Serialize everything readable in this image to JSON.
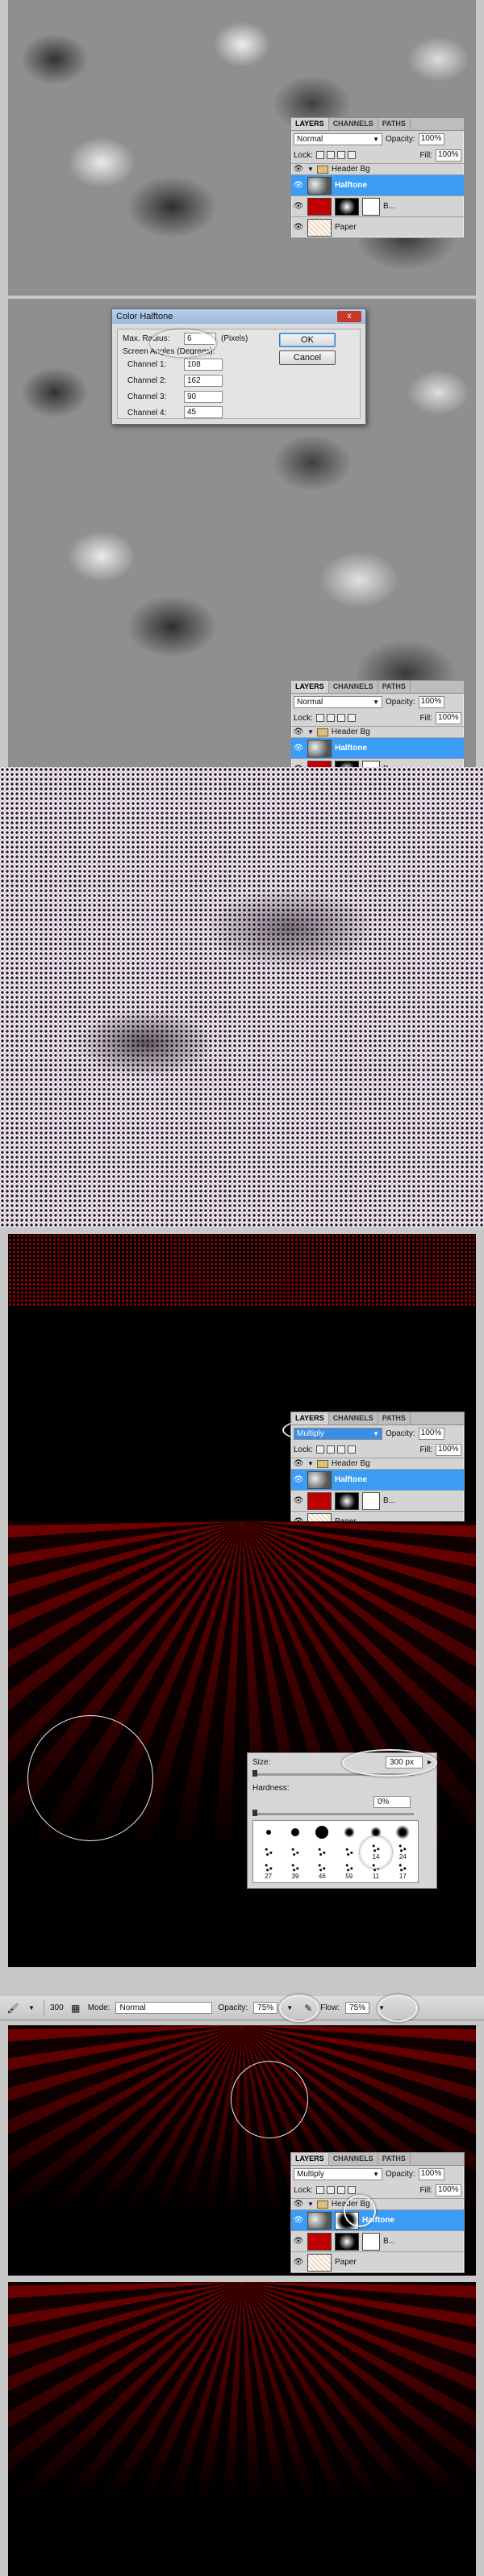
{
  "layers_panel": {
    "tabs": [
      "LAYERS",
      "CHANNELS",
      "PATHS"
    ],
    "blend_mode": "Normal",
    "blend_mode_multiply": "Multiply",
    "opacity_label": "Opacity:",
    "opacity_value": "100%",
    "lock_label": "Lock:",
    "fill_label": "Fill:",
    "fill_value": "100%",
    "group_name": "Header Bg",
    "layer_halftone": "Halftone",
    "layer_b": "B...",
    "layer_paper": "Paper"
  },
  "dialog": {
    "title": "Color Halftone",
    "close": "x",
    "max_radius_label": "Max. Radius:",
    "max_radius_value": "6",
    "pixels_label": "(Pixels)",
    "screen_angles_label": "Screen Angles (Degrees):",
    "channels": [
      {
        "label": "Channel 1:",
        "value": "108"
      },
      {
        "label": "Channel 2:",
        "value": "162"
      },
      {
        "label": "Channel 3:",
        "value": "90"
      },
      {
        "label": "Channel 4:",
        "value": "45"
      }
    ],
    "ok": "OK",
    "cancel": "Cancel"
  },
  "brush_panel": {
    "size_label": "Size:",
    "size_value": "300 px",
    "hardness_label": "Hardness:",
    "hardness_value": "0%",
    "brush_sizes": [
      "",
      "",
      "",
      "",
      "",
      "",
      "",
      "",
      "",
      "",
      "14",
      "24",
      "27",
      "39",
      "46",
      "59",
      "11",
      "17"
    ]
  },
  "options_bar": {
    "brush_size": "300",
    "mode_label": "Mode:",
    "mode_value": "Normal",
    "opacity_label": "Opacity:",
    "opacity_value": "75%",
    "flow_label": "Flow:",
    "flow_value": "75%"
  }
}
